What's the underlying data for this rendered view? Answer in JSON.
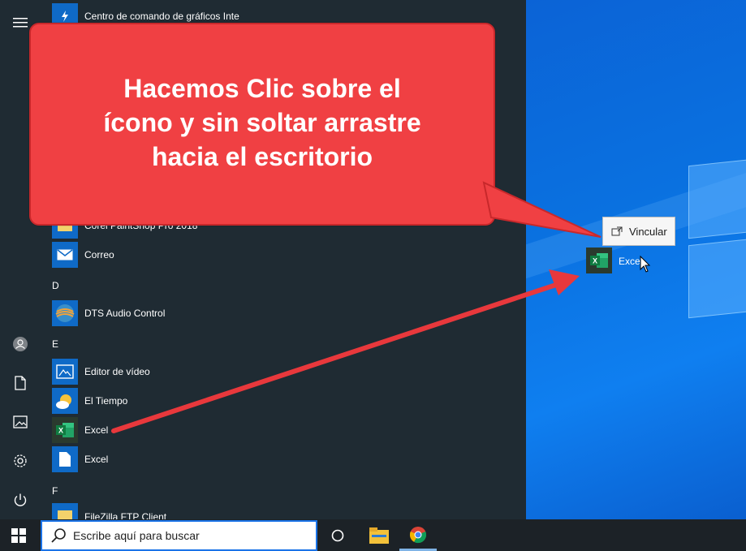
{
  "start_menu": {
    "top_item": "Centro de comando de gráficos Inte",
    "partial_item": "Corel PaintShop Pro 2018",
    "sections": [
      {
        "letter": "D"
      },
      {
        "letter": "E"
      },
      {
        "letter": "F"
      }
    ],
    "apps": {
      "correo": "Correo",
      "dts": "DTS Audio Control",
      "editor": "Editor de vídeo",
      "tiempo": "El Tiempo",
      "excel1": "Excel",
      "excel2": "Excel",
      "filezilla": "FileZilla FTP Client"
    }
  },
  "callout": {
    "line1": "Hacemos Clic sobre el",
    "line2": "ícono y sin soltar arrastre",
    "line3": "hacia el escritorio"
  },
  "drag": {
    "tooltip": "Vincular",
    "label": "Excel"
  },
  "taskbar": {
    "search_placeholder": "Escribe aquí para buscar"
  },
  "colors": {
    "callout": "#f04043",
    "menu_bg": "#1f2b33",
    "desktop": "#0a71e0",
    "tile_blue": "#0f6ac7",
    "excel_green": "#1d7044"
  }
}
